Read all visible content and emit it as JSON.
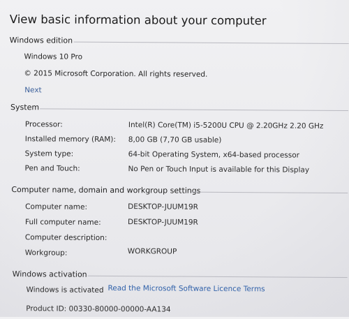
{
  "header": {
    "title": "View basic information about your computer"
  },
  "windows_edition": {
    "title": "Windows edition",
    "edition": "Windows 10 Pro",
    "copyright": "© 2015 Microsoft Corporation. All rights reserved.",
    "next_link": "Next"
  },
  "system": {
    "title": "System",
    "rows": [
      {
        "label": "Processor:",
        "value": "Intel(R) Core(TM) i5-5200U CPU @ 2.20GHz   2.20 GHz"
      },
      {
        "label": "Installed memory (RAM):",
        "value": "8,00 GB (7,70 GB usable)"
      },
      {
        "label": "System type:",
        "value": "64-bit Operating System, x64-based processor"
      },
      {
        "label": "Pen and Touch:",
        "value": "No Pen or Touch Input is available for this Display"
      }
    ]
  },
  "computer_name": {
    "title": "Computer name, domain and workgroup settings",
    "rows": [
      {
        "label": "Computer name:",
        "value": "DESKTOP-JUUM19R"
      },
      {
        "label": "Full computer name:",
        "value": "DESKTOP-JUUM19R"
      },
      {
        "label": "Computer description:",
        "value": ""
      },
      {
        "label": "Workgroup:",
        "value": "WORKGROUP"
      }
    ]
  },
  "activation": {
    "title": "Windows activation",
    "status": "Windows is activated",
    "license_link": "Read the Microsoft Software Licence Terms",
    "product_id": "Product ID: 00330-80000-00000-AA134"
  }
}
